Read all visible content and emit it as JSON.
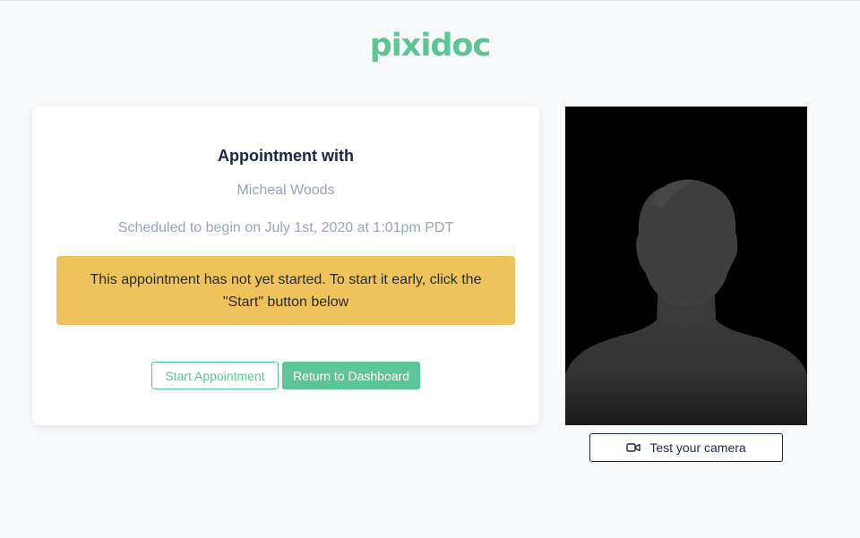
{
  "brand": {
    "logo_text": "pixidoc",
    "color": "#5cc595"
  },
  "appointment": {
    "title": "Appointment with",
    "doctor_name": "Micheal Woods",
    "schedule_text": "Scheduled to begin on July 1st, 2020 at 1:01pm PDT",
    "alert_text": "This appointment has not yet started. To start it early, click the \"Start\" button below",
    "alert_color": "#efc35c"
  },
  "actions": {
    "start_label": "Start Appointment",
    "dashboard_label": "Return to Dashboard"
  },
  "camera": {
    "preview_icon": "person-silhouette-icon",
    "test_label": "Test your camera",
    "test_icon": "video-camera-icon"
  }
}
